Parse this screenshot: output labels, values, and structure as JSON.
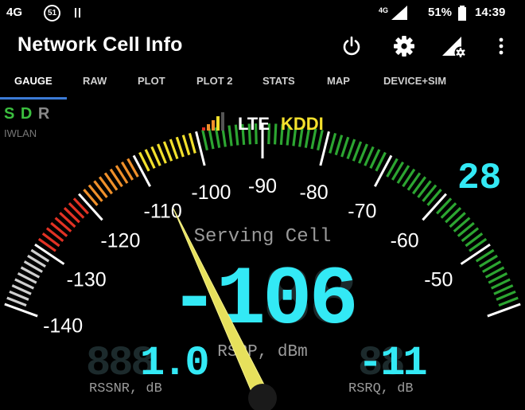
{
  "status_bar": {
    "network_label": "4G",
    "notification_badge": "51",
    "signal_type": "4G",
    "battery": "51%",
    "time": "14:39"
  },
  "app_bar": {
    "title": "Network Cell Info",
    "icons": [
      "power-icon",
      "gear-icon",
      "signal-settings-icon",
      "more-vert-icon"
    ]
  },
  "tabs": [
    {
      "label": "GAUGE",
      "active": true
    },
    {
      "label": "RAW"
    },
    {
      "label": "PLOT"
    },
    {
      "label": "PLOT 2"
    },
    {
      "label": "STATS"
    },
    {
      "label": "MAP"
    },
    {
      "label": "DEVICE+SIM"
    }
  ],
  "sim_status": {
    "s": "S",
    "d": "D",
    "r": "R",
    "iwlan": "IWLAN"
  },
  "network": {
    "tech": "LTE",
    "operator": "KDDI",
    "signal_bars": 4,
    "band": "28"
  },
  "gauge": {
    "caption": "Serving Cell",
    "scale_labels": [
      "-140",
      "-130",
      "-120",
      "-110",
      "-100",
      "-90",
      "-80",
      "-70",
      "-60",
      "-50"
    ],
    "min": -140,
    "max": -40,
    "needle_value": -108,
    "rsrp_value": "-106",
    "rsrp_ghost": "-188",
    "rsrp_label": "RSRP, dBm",
    "rssnr_value": "1.0",
    "rssnr_ghost": "888",
    "rssnr_label": "RSSNR, dB",
    "rsrq_value": "-11",
    "rsrq_ghost": "88",
    "rsrq_label": "RSRQ, dB",
    "colors": {
      "red": "#e23224",
      "orange": "#f0902a",
      "yellow": "#f2e02c",
      "green": "#2ca531",
      "gray": "#cfcfcf",
      "digit": "#33e9f5",
      "needle": "#e6e05c",
      "operator": "#f5e02d"
    }
  }
}
